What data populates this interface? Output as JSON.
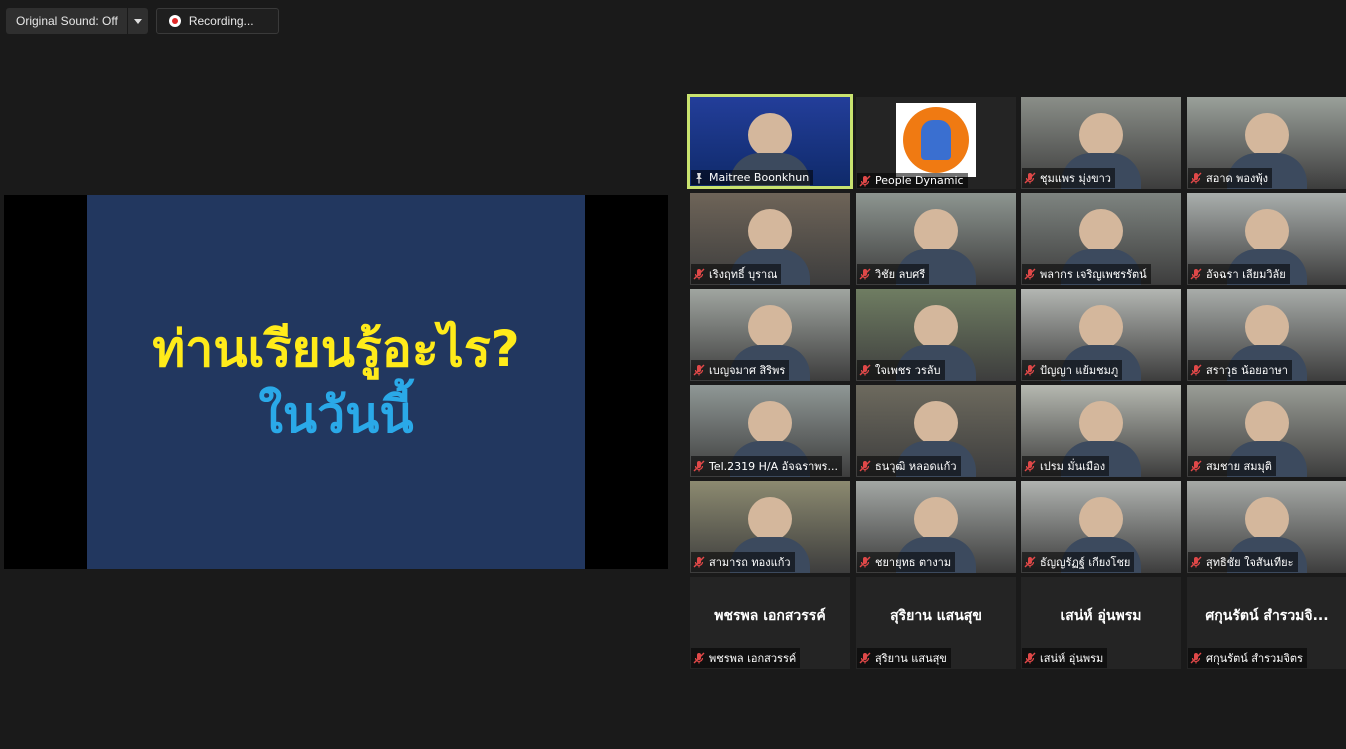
{
  "toolbar": {
    "original_sound_label": "Original Sound: Off",
    "recording_label": "Recording..."
  },
  "slide": {
    "line1": "ท่านเรียนรู้อะไร?",
    "line2": "ในวันนี้"
  },
  "participants": [
    {
      "name": "Maitree Boonkhun",
      "active": true,
      "muted": false,
      "video": true,
      "bg": "#1a3a8a",
      "mic_icon": "pin-icon"
    },
    {
      "name": "People Dynamic",
      "muted": true,
      "video": true,
      "bg": "#f2f2f2",
      "logo": true
    },
    {
      "name": "ชุมแพร มุ่งขาว",
      "muted": true,
      "video": true,
      "bg": "#8a8e88"
    },
    {
      "name": "สอาด พองพุ้ง",
      "muted": true,
      "video": true,
      "bg": "#9aa09a"
    },
    {
      "name": "เริงฤทธิ์ บุราณ",
      "muted": true,
      "video": true,
      "bg": "#6e6458"
    },
    {
      "name": "วิชัย ลบศรี",
      "muted": true,
      "video": true,
      "bg": "#8d9590"
    },
    {
      "name": "พลากร เจริญเพชรรัตน์",
      "muted": true,
      "video": true,
      "bg": "#7e8480"
    },
    {
      "name": "อัจฉรา เลียมวิลัย",
      "muted": true,
      "video": true,
      "bg": "#a9aeac"
    },
    {
      "name": "เบญจมาศ สิริพร",
      "muted": true,
      "video": true,
      "bg": "#a0a5a0"
    },
    {
      "name": "ใจเพชร วรลับ",
      "muted": true,
      "video": true,
      "bg": "#6f7d62"
    },
    {
      "name": "ปัญญา แย้มชมภู",
      "muted": true,
      "video": true,
      "bg": "#b3b6b2"
    },
    {
      "name": "สราวุธ น้อยอาษา",
      "muted": true,
      "video": true,
      "bg": "#a8aca9"
    },
    {
      "name": "Tel.2319 H/A อัจฉราพร...",
      "muted": true,
      "video": true,
      "bg": "#8f9795"
    },
    {
      "name": "ธนวุฒิ หลอดแก้ว",
      "muted": true,
      "video": true,
      "bg": "#6d6a5e"
    },
    {
      "name": "เปรม มั่นเมือง",
      "muted": true,
      "video": true,
      "bg": "#b5b8b0"
    },
    {
      "name": "สมชาย สมมุติ",
      "muted": true,
      "video": true,
      "bg": "#9a9d96"
    },
    {
      "name": "สามารถ ทองแก้ว",
      "muted": true,
      "video": true,
      "bg": "#8c8a70"
    },
    {
      "name": "ชยายุทธ ตางาม",
      "muted": true,
      "video": true,
      "bg": "#a3a7a4"
    },
    {
      "name": "ธัญญรัฏฐ์ เกียงโชย",
      "muted": true,
      "video": true,
      "bg": "#b0b3b0"
    },
    {
      "name": "สุทธิชัย ใจสันเทียะ",
      "muted": true,
      "video": true,
      "bg": "#a6a9a6"
    },
    {
      "name": "พชรพล เอกสวรรค์",
      "muted": true,
      "video": false,
      "display": "พชรพล เอกสวรรค์"
    },
    {
      "name": "สุริยาน แสนสุข",
      "muted": true,
      "video": false,
      "display": "สุริยาน แสนสุข"
    },
    {
      "name": "เสน่ห์ อุ่นพรม",
      "muted": true,
      "video": false,
      "display": "เสน่ห์ อุ่นพรม"
    },
    {
      "name": "ศกุนรัตน์ สำรวมจิตร",
      "muted": true,
      "video": false,
      "display": "ศกุนรัตน์ สำรวมจิ..."
    }
  ]
}
